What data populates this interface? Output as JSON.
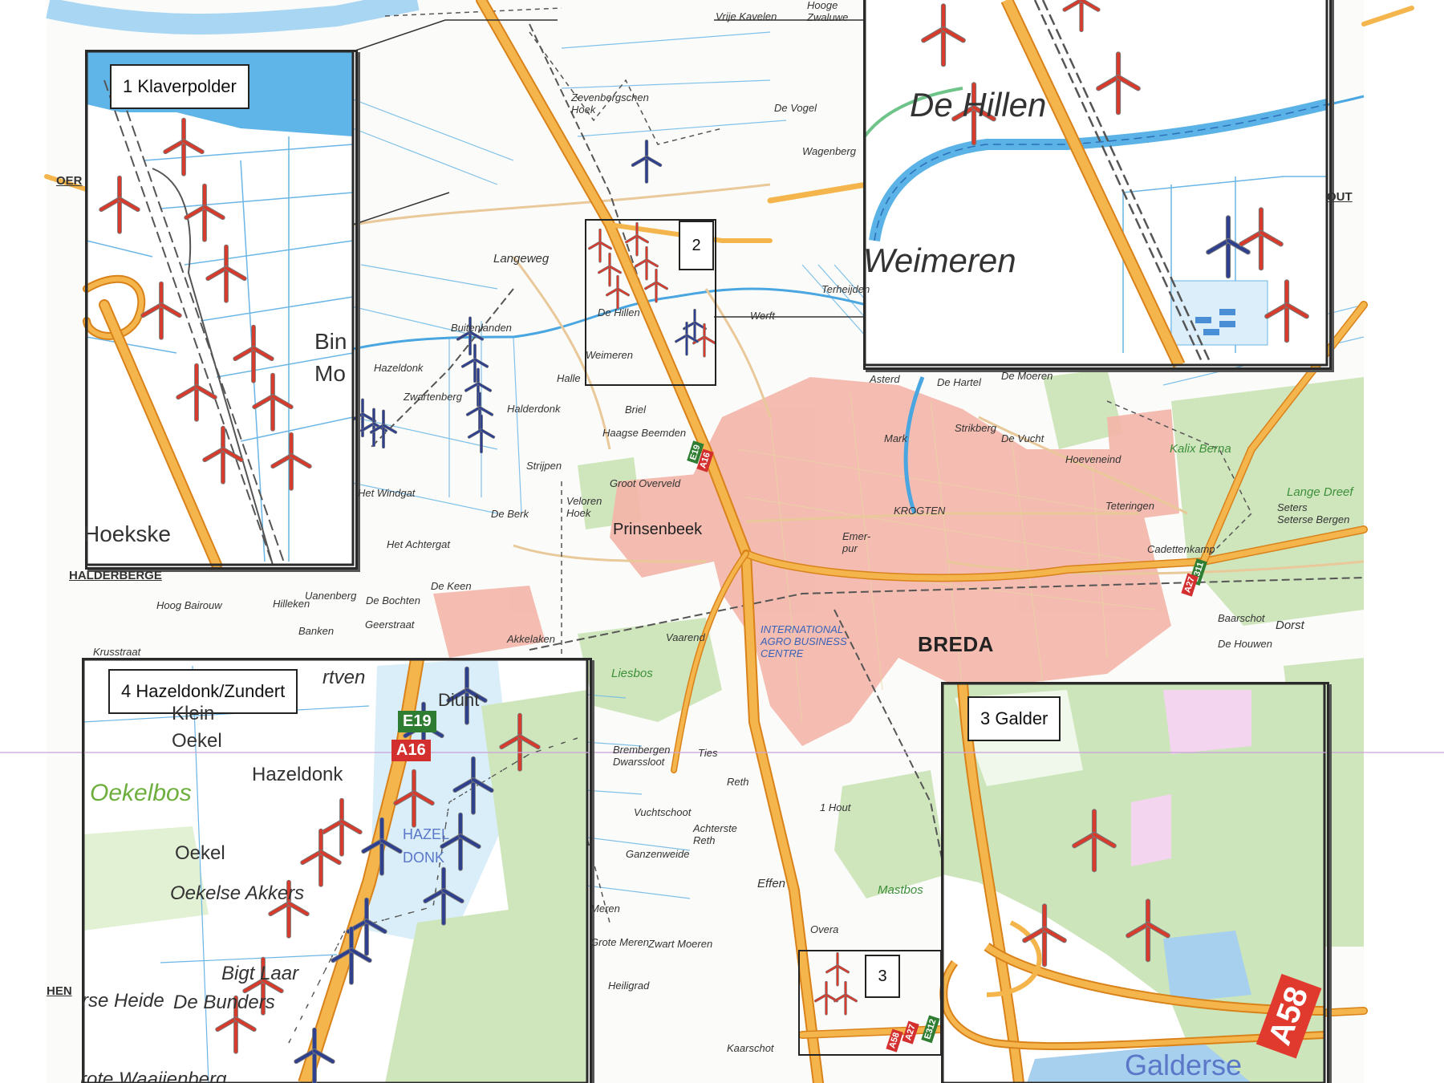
{
  "map": {
    "main_labels": [
      {
        "id": "zevenbergschen-hoek",
        "text": "Zevenbergschen\nHoek"
      },
      {
        "id": "hooge-zwaluwe",
        "text": "Hooge\nZwaluwe"
      },
      {
        "id": "vrije-kavelen",
        "text": "Vrije Kavelen"
      },
      {
        "id": "de-vogel",
        "text": "De Vogel"
      },
      {
        "id": "wagenberg",
        "text": "Wagenberg"
      },
      {
        "id": "langeweg",
        "text": "Langeweg"
      },
      {
        "id": "terheijden",
        "text": "Terheijden"
      },
      {
        "id": "werft",
        "text": "Werft"
      },
      {
        "id": "buitenlanden",
        "text": "Buitenlanden"
      },
      {
        "id": "hazeldonk-main",
        "text": "Hazeldonk"
      },
      {
        "id": "zwartenberg",
        "text": "Zwartenberg"
      },
      {
        "id": "halle",
        "text": "Halle"
      },
      {
        "id": "halderdonk",
        "text": "Halderdonk"
      },
      {
        "id": "de-hillen-main",
        "text": "De Hillen"
      },
      {
        "id": "weimeren-main",
        "text": "Weimeren"
      },
      {
        "id": "briel",
        "text": "Briel"
      },
      {
        "id": "haagse-beemden",
        "text": "Haagse Beemden"
      },
      {
        "id": "strijpen",
        "text": "Strijpen"
      },
      {
        "id": "groot-overveld",
        "text": "Groot Overveld"
      },
      {
        "id": "het-windgat",
        "text": "Het Windgat"
      },
      {
        "id": "de-berk",
        "text": "De Berk"
      },
      {
        "id": "veloren-hoek",
        "text": "Veloren\nHoek"
      },
      {
        "id": "prinsenbeek",
        "text": "Prinsenbeek"
      },
      {
        "id": "het-achtergat",
        "text": "Het Achtergat"
      },
      {
        "id": "de-keen",
        "text": "De Keen"
      },
      {
        "id": "halderberge",
        "text": "HALDERBERGE"
      },
      {
        "id": "hoog-bairouw",
        "text": "Hoog Bairouw"
      },
      {
        "id": "hilleken",
        "text": "Hilleken"
      },
      {
        "id": "uanenberg",
        "text": "Uanenberg"
      },
      {
        "id": "de-bochten",
        "text": "De Bochten"
      },
      {
        "id": "geerstraat",
        "text": "Geerstraat"
      },
      {
        "id": "banken",
        "text": "Banken"
      },
      {
        "id": "krusstraat",
        "text": "Krusstraat"
      },
      {
        "id": "akkelaken",
        "text": "Akkelaken"
      },
      {
        "id": "vaarend",
        "text": "Vaarend"
      },
      {
        "id": "liesbos",
        "text": "Liesbos"
      },
      {
        "id": "international-centre",
        "text": "INTERNATIONAL\nAGRO BUSINESS\nCENTRE"
      },
      {
        "id": "breda",
        "text": "BREDA"
      },
      {
        "id": "asterd",
        "text": "Asterd"
      },
      {
        "id": "de-hartel",
        "text": "De Hartel"
      },
      {
        "id": "de-moeren",
        "text": "De Moeren"
      },
      {
        "id": "strikberg",
        "text": "Strikberg"
      },
      {
        "id": "de-vucht",
        "text": "De Vucht"
      },
      {
        "id": "hoeveneind",
        "text": "Hoeveneind"
      },
      {
        "id": "kalix-berna",
        "text": "Kalix Berna"
      },
      {
        "id": "lange-dreef",
        "text": "Lange Dreef"
      },
      {
        "id": "seters",
        "text": "Seters\nSeterse Bergen"
      },
      {
        "id": "teteringen",
        "text": "Teteringen"
      },
      {
        "id": "krogten",
        "text": "KROGTEN"
      },
      {
        "id": "emer",
        "text": "Emer-\npur"
      },
      {
        "id": "mark",
        "text": "Mark"
      },
      {
        "id": "cadettenkamp",
        "text": "Cadettenkamp"
      },
      {
        "id": "baarschot",
        "text": "Baarschot"
      },
      {
        "id": "dorst",
        "text": "Dorst"
      },
      {
        "id": "de-houwen",
        "text": "De Houwen"
      },
      {
        "id": "brembergen",
        "text": "Brembergen\nDwarssloot"
      },
      {
        "id": "ties",
        "text": "Ties"
      },
      {
        "id": "reth",
        "text": "Reth"
      },
      {
        "id": "vuchtschoot",
        "text": "Vuchtschoot"
      },
      {
        "id": "achterste-reth",
        "text": "Achterste\nReth"
      },
      {
        "id": "ganzenweide",
        "text": "Ganzenweide"
      },
      {
        "id": "1-hout",
        "text": "1 Hout"
      },
      {
        "id": "effen",
        "text": "Effen"
      },
      {
        "id": "mastbos",
        "text": "Mastbos"
      },
      {
        "id": "overa",
        "text": "Overa"
      },
      {
        "id": "zwart-moeren",
        "text": "Zwart Moeren"
      },
      {
        "id": "grote-meren",
        "text": "Grote Meren"
      },
      {
        "id": "meren",
        "text": "Meren"
      },
      {
        "id": "heiligrad",
        "text": "Heiligrad"
      },
      {
        "id": "kaarschot",
        "text": "Kaarschot"
      },
      {
        "id": "het-out",
        "text": "OUT"
      },
      {
        "id": "hen",
        "text": "HEN"
      },
      {
        "id": "oer",
        "text": "OER"
      }
    ],
    "road_shields": [
      {
        "id": "e19",
        "text": "E19",
        "kind": "e"
      },
      {
        "id": "a16",
        "text": "A16",
        "kind": "a"
      },
      {
        "id": "e311",
        "text": "E311",
        "kind": "e"
      },
      {
        "id": "a27",
        "text": "A27",
        "kind": "a"
      },
      {
        "id": "a58-small",
        "text": "A58",
        "kind": "a"
      },
      {
        "id": "a27-small",
        "text": "A27",
        "kind": "a"
      },
      {
        "id": "e312",
        "text": "E312",
        "kind": "e"
      }
    ],
    "marker_boxes": [
      {
        "id": "marker-2",
        "label": "2"
      },
      {
        "id": "marker-3",
        "label": "3"
      }
    ]
  },
  "insets": [
    {
      "id": "inset-1",
      "title": "1 Klaverpolder",
      "labels": [
        {
          "id": "bin",
          "text": "Bin"
        },
        {
          "id": "mo",
          "text": "Mo"
        },
        {
          "id": "hoekske",
          "text": "Hoekske"
        }
      ]
    },
    {
      "id": "inset-2",
      "title": "",
      "labels": [
        {
          "id": "de-hillen",
          "text": "De Hillen"
        },
        {
          "id": "weimeren",
          "text": "Weimeren"
        }
      ]
    },
    {
      "id": "inset-3",
      "title": "3 Galder",
      "labels": [
        {
          "id": "galderse",
          "text": "Galderse"
        },
        {
          "id": "a58",
          "text": "A58"
        }
      ]
    },
    {
      "id": "inset-4",
      "title": "4 Hazeldonk/Zundert",
      "labels": [
        {
          "id": "rtven",
          "text": "rtven"
        },
        {
          "id": "klein",
          "text": "Klein"
        },
        {
          "id": "oekel-1",
          "text": "Oekel"
        },
        {
          "id": "hazeldonk",
          "text": "Hazeldonk"
        },
        {
          "id": "oekelbos",
          "text": "Oekelbos"
        },
        {
          "id": "oekel-2",
          "text": "Oekel"
        },
        {
          "id": "oekelse-akkers",
          "text": "Oekelse Akkers"
        },
        {
          "id": "bigt-laar",
          "text": "Bigt Laar"
        },
        {
          "id": "rse-heide",
          "text": "rse Heide"
        },
        {
          "id": "de-bunders",
          "text": "De Bunders"
        },
        {
          "id": "waaijenberg",
          "text": "rote Waaijenberg"
        },
        {
          "id": "hazel-donk",
          "text": "HAZEL\nDONK"
        },
        {
          "id": "diunt",
          "text": "Diunt"
        },
        {
          "id": "e19-inset",
          "text": "E19"
        },
        {
          "id": "a16-inset",
          "text": "A16"
        }
      ]
    }
  ],
  "colors": {
    "highway": "#f2a531",
    "water": "#5bb3e8",
    "urban": "#f3b0a4",
    "forest": "#c9e4b7",
    "turbine_planned": "#d83a2c",
    "turbine_existing": "#2d3f8e",
    "rail": "#555555"
  }
}
